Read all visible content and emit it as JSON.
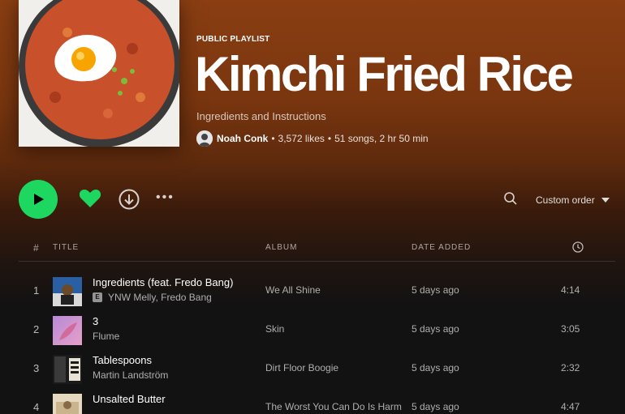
{
  "playlist": {
    "type_label": "PUBLIC PLAYLIST",
    "title": "Kimchi Fried Rice",
    "description": "Ingredients and Instructions",
    "owner": "Noah Conk",
    "likes": "3,572 likes",
    "songs": "51 songs,",
    "duration": "2 hr 50 min"
  },
  "actions": {
    "play_icon": "play-icon",
    "heart_icon": "heart-icon",
    "download_icon": "download-icon",
    "more_label": "•••",
    "search_icon": "search-icon",
    "sort_label": "Custom order"
  },
  "table": {
    "headers": {
      "num": "#",
      "title": "TITLE",
      "album": "ALBUM",
      "date_added": "DATE ADDED",
      "duration_icon": "clock-icon"
    },
    "rows": [
      {
        "num": "1",
        "title": "Ingredients (feat. Fredo Bang)",
        "explicit": "E",
        "artist": "YNW Melly, Fredo Bang",
        "album": "We All Shine",
        "date_added": "5 days ago",
        "duration": "4:14"
      },
      {
        "num": "2",
        "title": "3",
        "artist": "Flume",
        "album": "Skin",
        "date_added": "5 days ago",
        "duration": "3:05"
      },
      {
        "num": "3",
        "title": "Tablespoons",
        "artist": "Martin Landström",
        "album": "Dirt Floor Boogie",
        "date_added": "5 days ago",
        "duration": "2:32"
      },
      {
        "num": "4",
        "title": "Unsalted Butter",
        "artist": "",
        "album": "The Worst You Can Do Is Harm",
        "date_added": "5 days ago",
        "duration": "4:47"
      }
    ]
  },
  "colors": {
    "accent": "#1ed760",
    "header_bg": "#8a3e12",
    "page_bg": "#121212"
  }
}
